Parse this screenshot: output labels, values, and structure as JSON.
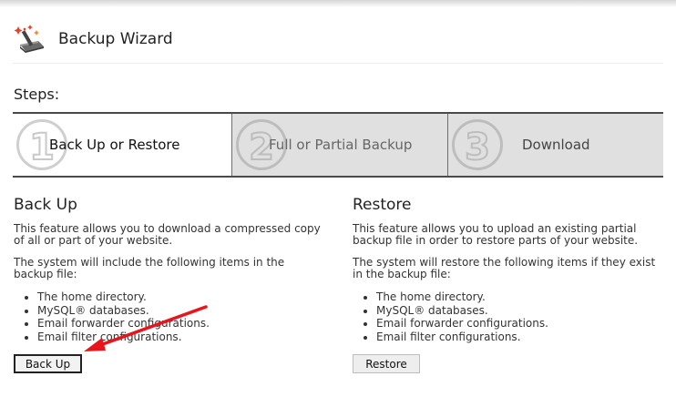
{
  "header": {
    "title": "Backup Wizard",
    "icon": "backup-wizard-icon"
  },
  "steps": {
    "label": "Steps:",
    "items": [
      {
        "number": "1",
        "label": "Back Up or Restore",
        "state": "active"
      },
      {
        "number": "2",
        "label": "Full or Partial Backup",
        "state": "inactive"
      },
      {
        "number": "3",
        "label": "Download",
        "state": "inactive"
      }
    ]
  },
  "backup": {
    "heading": "Back Up",
    "description": "This feature allows you to download a compressed copy of all or part of your website.",
    "include_text": "The system will include the following items in the backup file:",
    "items": [
      "The home directory.",
      "MySQL® databases.",
      "Email forwarder configurations.",
      "Email filter configurations."
    ],
    "button_label": "Back Up"
  },
  "restore": {
    "heading": "Restore",
    "description": "This feature allows you to upload an existing partial backup file in order to restore parts of your website.",
    "restore_text": "The system will restore the following items if they exist in the backup file:",
    "items": [
      "The home directory.",
      "MySQL® databases.",
      "Email forwarder configurations.",
      "Email filter configurations."
    ],
    "button_label": "Restore"
  },
  "colors": {
    "annotation_arrow": "#e8151c",
    "active_step_bg": "#ffffff",
    "inactive_step_bg": "#e0e0e0"
  }
}
